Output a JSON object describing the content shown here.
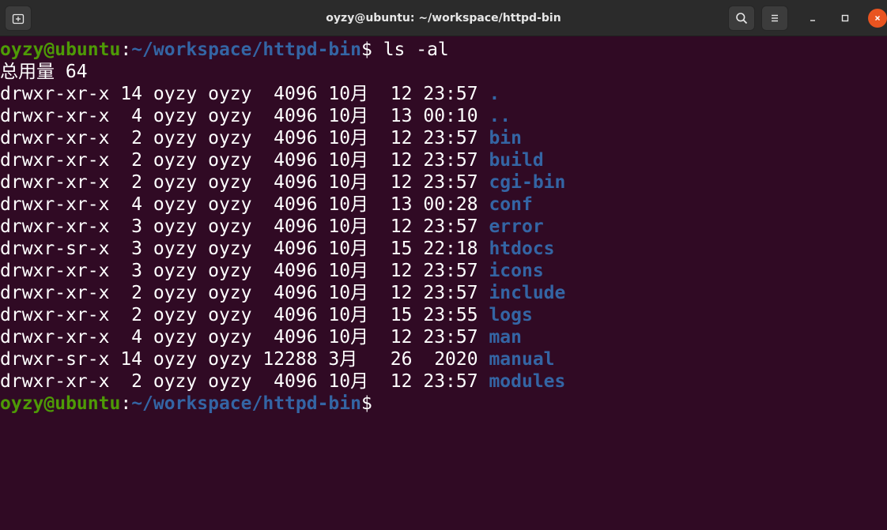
{
  "window": {
    "title": "oyzy@ubuntu: ~/workspace/httpd-bin",
    "colors": {
      "background": "#300a24",
      "titlebar": "#2b2b2b",
      "close_button": "#e95420",
      "prompt_user": "#4e9a06",
      "prompt_path": "#3465a4",
      "directory": "#3465a4"
    }
  },
  "titlebar_icons": {
    "new_tab": "new-tab-icon",
    "search": "search-icon",
    "menu": "hamburger-menu-icon",
    "minimize": "minimize-icon",
    "maximize": "maximize-icon",
    "close": "close-icon"
  },
  "terminal": {
    "prompt": {
      "user_host": "oyzy@ubuntu",
      "sep": ":",
      "path": "~/workspace/httpd-bin",
      "symbol": "$"
    },
    "command": " ls -al",
    "total_line": "总用量 64",
    "listing": [
      {
        "meta": "drwxr-xr-x 14 oyzy oyzy  4096 10月  12 23:57 ",
        "name": "."
      },
      {
        "meta": "drwxr-xr-x  4 oyzy oyzy  4096 10月  13 00:10 ",
        "name": ".."
      },
      {
        "meta": "drwxr-xr-x  2 oyzy oyzy  4096 10月  12 23:57 ",
        "name": "bin"
      },
      {
        "meta": "drwxr-xr-x  2 oyzy oyzy  4096 10月  12 23:57 ",
        "name": "build"
      },
      {
        "meta": "drwxr-xr-x  2 oyzy oyzy  4096 10月  12 23:57 ",
        "name": "cgi-bin"
      },
      {
        "meta": "drwxr-xr-x  4 oyzy oyzy  4096 10月  13 00:28 ",
        "name": "conf"
      },
      {
        "meta": "drwxr-xr-x  3 oyzy oyzy  4096 10月  12 23:57 ",
        "name": "error"
      },
      {
        "meta": "drwxr-sr-x  3 oyzy oyzy  4096 10月  15 22:18 ",
        "name": "htdocs"
      },
      {
        "meta": "drwxr-xr-x  3 oyzy oyzy  4096 10月  12 23:57 ",
        "name": "icons"
      },
      {
        "meta": "drwxr-xr-x  2 oyzy oyzy  4096 10月  12 23:57 ",
        "name": "include"
      },
      {
        "meta": "drwxr-xr-x  2 oyzy oyzy  4096 10月  15 23:55 ",
        "name": "logs"
      },
      {
        "meta": "drwxr-xr-x  4 oyzy oyzy  4096 10月  12 23:57 ",
        "name": "man"
      },
      {
        "meta": "drwxr-sr-x 14 oyzy oyzy 12288 3月   26  2020 ",
        "name": "manual"
      },
      {
        "meta": "drwxr-xr-x  2 oyzy oyzy  4096 10月  12 23:57 ",
        "name": "modules"
      }
    ]
  }
}
